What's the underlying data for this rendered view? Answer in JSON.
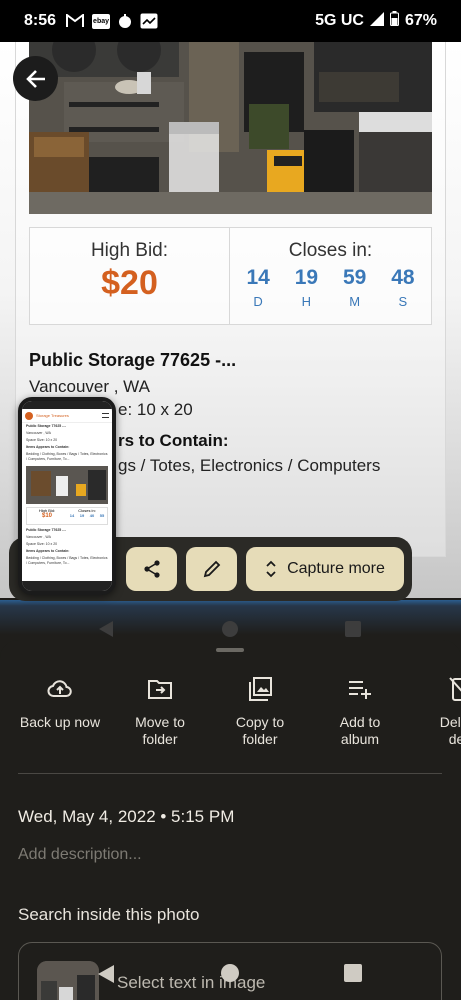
{
  "status_bar": {
    "time": "8:56",
    "network": "5G UC",
    "battery": "67%",
    "icons": [
      "gmail-icon",
      "ebay-icon",
      "notification-icon",
      "news-icon",
      "signal-icon",
      "battery-icon"
    ],
    "ebay_text": "ebay"
  },
  "listing": {
    "high_bid_label": "High Bid:",
    "high_bid_value": "$20",
    "closes_label": "Closes in:",
    "countdown": [
      {
        "value": "14",
        "unit": "D"
      },
      {
        "value": "19",
        "unit": "H"
      },
      {
        "value": "59",
        "unit": "M"
      },
      {
        "value": "48",
        "unit": "S"
      }
    ],
    "title": "Public Storage 77625 -...",
    "location": "Vancouver , WA",
    "size_partial": "e: 10 x 20",
    "contents_heading_partial": "rs to Contain:",
    "contents_partial": "gs / Totes, Electronics / Computers"
  },
  "thumbnail": {
    "logo_text": "Storage Treasures",
    "title": "Public Storage 77625 -...",
    "location": "Vancouver , WA",
    "size": "Space Size: 10 x 20",
    "contents_heading": "Items Appears to Contain:",
    "contents": "Bedding / Clothing, Boxes / Bags / Totes, Electronics / Computers, Furniture, To...",
    "bid_label": "High Bid:",
    "bid_value": "$10",
    "closes_label": "Closes in:",
    "countdown": [
      "14",
      "19",
      "40",
      "55"
    ]
  },
  "capture_toolbar": {
    "capture_more_label": "Capture more"
  },
  "sheet": {
    "actions": [
      {
        "label": "Back up now",
        "icon": "cloud-upload-icon"
      },
      {
        "label": "Move to folder",
        "icon": "move-folder-icon"
      },
      {
        "label": "Copy to folder",
        "icon": "copy-folder-icon"
      },
      {
        "label": "Add to album",
        "icon": "add-to-album-icon"
      },
      {
        "label": "Delete from device",
        "icon": "delete-device-icon"
      }
    ],
    "action_labels": {
      "backup_l1": "Back up now",
      "move_l1": "Move to",
      "move_l2": "folder",
      "copy_l1": "Copy to",
      "copy_l2": "folder",
      "album_l1": "Add to",
      "album_l2": "album",
      "delete_l1": "Delete",
      "delete_l2": "dev"
    },
    "datetime": "Wed, May 4, 2022  •  5:15 PM",
    "description_placeholder": "Add description...",
    "search_heading": "Search inside this photo",
    "search_action": "Select text in image"
  }
}
